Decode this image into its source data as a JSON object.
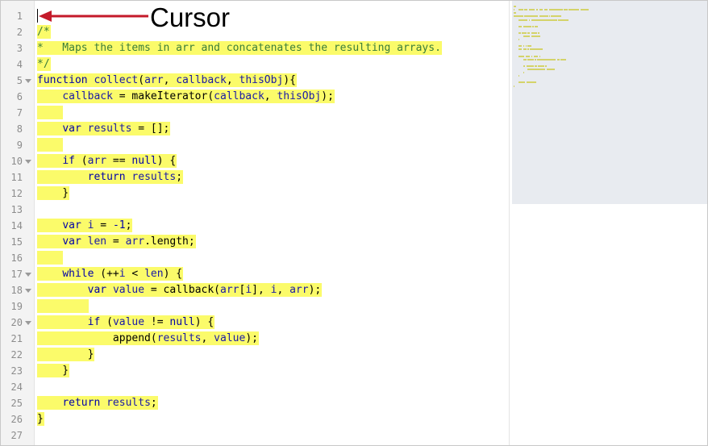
{
  "annotation": {
    "label": "Cursor",
    "arrow_color": "#c41a2a"
  },
  "colors": {
    "highlight": "#fbfb6a",
    "keyword": "#0000a8",
    "identifier": "#1a1aa6",
    "comment": "#3a7d3a"
  },
  "lines": [
    {
      "n": "1",
      "fold": false,
      "segs": []
    },
    {
      "n": "2",
      "fold": false,
      "segs": [
        {
          "t": "/*",
          "c": "cm"
        }
      ]
    },
    {
      "n": "3",
      "fold": false,
      "segs": [
        {
          "t": "*   Maps the items in arr and concatenates the resulting arrays.",
          "c": "cm"
        }
      ]
    },
    {
      "n": "4",
      "fold": false,
      "segs": [
        {
          "t": "*/",
          "c": "cm"
        }
      ]
    },
    {
      "n": "5",
      "fold": true,
      "segs": [
        {
          "t": "function ",
          "c": "kw"
        },
        {
          "t": "collect",
          "c": "id"
        },
        {
          "t": "(",
          "c": "pl"
        },
        {
          "t": "arr",
          "c": "id"
        },
        {
          "t": ", ",
          "c": "pl"
        },
        {
          "t": "callback",
          "c": "id"
        },
        {
          "t": ", ",
          "c": "pl"
        },
        {
          "t": "thisObj",
          "c": "id"
        },
        {
          "t": "){",
          "c": "pl"
        }
      ]
    },
    {
      "n": "6",
      "fold": false,
      "segs": [
        {
          "t": "    ",
          "c": "pl"
        },
        {
          "t": "callback",
          "c": "id"
        },
        {
          "t": " = makeIterator(",
          "c": "pl"
        },
        {
          "t": "callback",
          "c": "id"
        },
        {
          "t": ", ",
          "c": "pl"
        },
        {
          "t": "thisObj",
          "c": "id"
        },
        {
          "t": ");",
          "c": "pl"
        }
      ]
    },
    {
      "n": "7",
      "fold": false,
      "segs": [
        {
          "t": "    ",
          "c": "pl"
        }
      ]
    },
    {
      "n": "8",
      "fold": false,
      "segs": [
        {
          "t": "    ",
          "c": "pl"
        },
        {
          "t": "var ",
          "c": "kw"
        },
        {
          "t": "results",
          "c": "id"
        },
        {
          "t": " = [];",
          "c": "pl"
        }
      ]
    },
    {
      "n": "9",
      "fold": false,
      "segs": [
        {
          "t": "    ",
          "c": "pl"
        }
      ]
    },
    {
      "n": "10",
      "fold": true,
      "segs": [
        {
          "t": "    ",
          "c": "pl"
        },
        {
          "t": "if ",
          "c": "kw"
        },
        {
          "t": "(",
          "c": "pl"
        },
        {
          "t": "arr",
          "c": "id"
        },
        {
          "t": " == ",
          "c": "pl"
        },
        {
          "t": "null",
          "c": "kw"
        },
        {
          "t": ") {",
          "c": "pl"
        }
      ]
    },
    {
      "n": "11",
      "fold": false,
      "segs": [
        {
          "t": "        ",
          "c": "pl"
        },
        {
          "t": "return ",
          "c": "kw"
        },
        {
          "t": "results",
          "c": "id"
        },
        {
          "t": ";",
          "c": "pl"
        }
      ]
    },
    {
      "n": "12",
      "fold": false,
      "segs": [
        {
          "t": "    }",
          "c": "pl"
        }
      ]
    },
    {
      "n": "13",
      "fold": false,
      "segs": []
    },
    {
      "n": "14",
      "fold": false,
      "segs": [
        {
          "t": "    ",
          "c": "pl"
        },
        {
          "t": "var ",
          "c": "kw"
        },
        {
          "t": "i",
          "c": "id"
        },
        {
          "t": " = ",
          "c": "pl"
        },
        {
          "t": "-1",
          "c": "num"
        },
        {
          "t": ";",
          "c": "pl"
        }
      ]
    },
    {
      "n": "15",
      "fold": false,
      "segs": [
        {
          "t": "    ",
          "c": "pl"
        },
        {
          "t": "var ",
          "c": "kw"
        },
        {
          "t": "len",
          "c": "id"
        },
        {
          "t": " = ",
          "c": "pl"
        },
        {
          "t": "arr",
          "c": "id"
        },
        {
          "t": ".length;",
          "c": "pl"
        }
      ]
    },
    {
      "n": "16",
      "fold": false,
      "segs": [
        {
          "t": "    ",
          "c": "pl"
        }
      ]
    },
    {
      "n": "17",
      "fold": true,
      "segs": [
        {
          "t": "    ",
          "c": "pl"
        },
        {
          "t": "while ",
          "c": "kw"
        },
        {
          "t": "(++",
          "c": "pl"
        },
        {
          "t": "i",
          "c": "id"
        },
        {
          "t": " < ",
          "c": "pl"
        },
        {
          "t": "len",
          "c": "id"
        },
        {
          "t": ") {",
          "c": "pl"
        }
      ]
    },
    {
      "n": "18",
      "fold": true,
      "segs": [
        {
          "t": "        ",
          "c": "pl"
        },
        {
          "t": "var ",
          "c": "kw"
        },
        {
          "t": "value",
          "c": "id"
        },
        {
          "t": " = callback(",
          "c": "pl"
        },
        {
          "t": "arr",
          "c": "id"
        },
        {
          "t": "[",
          "c": "pl"
        },
        {
          "t": "i",
          "c": "id"
        },
        {
          "t": "], ",
          "c": "pl"
        },
        {
          "t": "i",
          "c": "id"
        },
        {
          "t": ", ",
          "c": "pl"
        },
        {
          "t": "arr",
          "c": "id"
        },
        {
          "t": ");",
          "c": "pl"
        }
      ]
    },
    {
      "n": "19",
      "fold": false,
      "segs": [
        {
          "t": "        ",
          "c": "pl"
        }
      ]
    },
    {
      "n": "20",
      "fold": true,
      "segs": [
        {
          "t": "        ",
          "c": "pl"
        },
        {
          "t": "if ",
          "c": "kw"
        },
        {
          "t": "(",
          "c": "pl"
        },
        {
          "t": "value",
          "c": "id"
        },
        {
          "t": " != ",
          "c": "pl"
        },
        {
          "t": "null",
          "c": "kw"
        },
        {
          "t": ") {",
          "c": "pl"
        }
      ]
    },
    {
      "n": "21",
      "fold": false,
      "segs": [
        {
          "t": "            append(",
          "c": "pl"
        },
        {
          "t": "results",
          "c": "id"
        },
        {
          "t": ", ",
          "c": "pl"
        },
        {
          "t": "value",
          "c": "id"
        },
        {
          "t": ");",
          "c": "pl"
        }
      ]
    },
    {
      "n": "22",
      "fold": false,
      "segs": [
        {
          "t": "        }",
          "c": "pl"
        }
      ]
    },
    {
      "n": "23",
      "fold": false,
      "segs": [
        {
          "t": "    }",
          "c": "pl"
        }
      ]
    },
    {
      "n": "24",
      "fold": false,
      "segs": []
    },
    {
      "n": "25",
      "fold": false,
      "segs": [
        {
          "t": "    ",
          "c": "pl"
        },
        {
          "t": "return ",
          "c": "kw"
        },
        {
          "t": "results",
          "c": "id"
        },
        {
          "t": ";",
          "c": "pl"
        }
      ]
    },
    {
      "n": "26",
      "fold": false,
      "segs": [
        {
          "t": "}",
          "c": "pl"
        }
      ]
    },
    {
      "n": "27",
      "fold": false,
      "segs": []
    }
  ]
}
